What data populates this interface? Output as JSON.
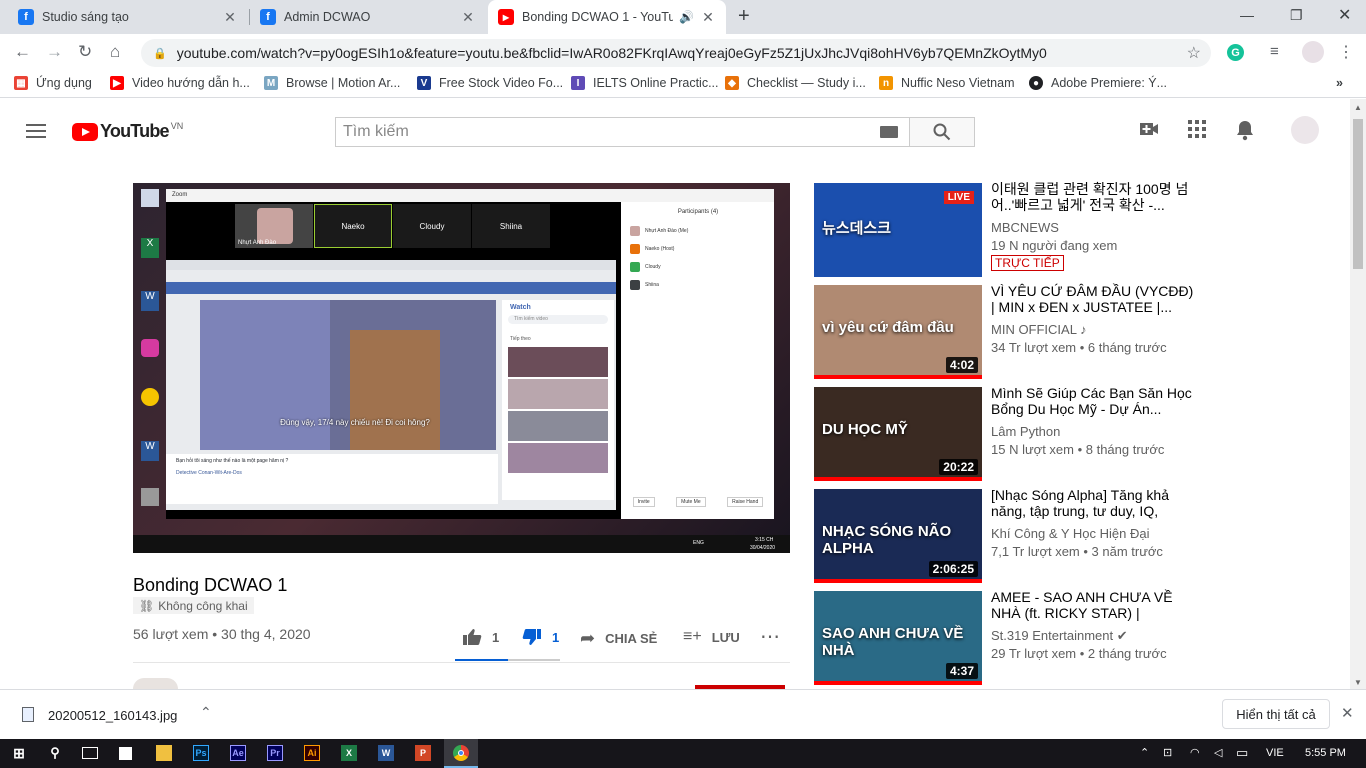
{
  "tabs": [
    {
      "title": "Studio sáng tạo",
      "color": "#1877f2",
      "glyph": "f"
    },
    {
      "title": "Admin DCWAO",
      "color": "#1877f2",
      "glyph": "f"
    },
    {
      "title": "Bonding DCWAO 1 - YouTub",
      "color": "#ff0000",
      "glyph": "▶"
    }
  ],
  "address": "youtube.com/watch?v=py0ogESIh1o&feature=youtu.be&fbclid=IwAR0o82FKrqIAwqYreaj0eGyFz5Z1jUxJhcJVqi8ohHV6yb7QEMnZkOytMy0",
  "bookmarks": [
    {
      "label": "Ứng dụng",
      "color": "#ea4335"
    },
    {
      "label": "Video hướng dẫn h...",
      "color": "#ff0000"
    },
    {
      "label": "Browse | Motion Ar...",
      "color": "#7aa6c2"
    },
    {
      "label": "Free Stock Video Fo...",
      "color": "#1a3a8f"
    },
    {
      "label": "IELTS Online Practic...",
      "color": "#5f4bb6"
    },
    {
      "label": "Checklist — Study i...",
      "color": "#e8710a"
    },
    {
      "label": "Nuffic Neso Vietnam",
      "color": "#f29400"
    },
    {
      "label": "Adobe Premiere: Ý...",
      "color": "#202124"
    }
  ],
  "youtube": {
    "logo_text": "YouTube",
    "region": "VN",
    "search_placeholder": "Tìm kiếm"
  },
  "video": {
    "title": "Bonding DCWAO 1",
    "visibility": "Không công khai",
    "views_date": "56 lượt xem • 30 thg 4, 2020",
    "likes": "1",
    "dislikes": "1",
    "share": "CHIA SẺ",
    "save": "LƯU",
    "like_ratio": 0.5
  },
  "inner": {
    "zoom_title": "Zoom",
    "participants_header": "Participants (4)",
    "participants": [
      "Nhựt Anh Đào (Me)",
      "Naeko (Host)",
      "Cloudy",
      "Shiina"
    ],
    "tiles": [
      "Nhựt Anh Đào",
      "Naeko",
      "Cloudy",
      "Shiina"
    ],
    "buttons": [
      "Invite",
      "Mute Me",
      "Raise Hand"
    ],
    "subtitle": "Đúng vậy, 17/4 này chiếu nè! Đi coi hông?",
    "watch": "Watch",
    "search_video": "Tìm kiếm video",
    "up_next": "Tiếp theo",
    "post_q": "Bạn hỏi tôi sáng như thế nào là một page hâm nị ?",
    "page_name": "Detective Conan-Wit-Are-Dos",
    "time": "3:15 CH",
    "date": "30/04/2020",
    "lang": "ENG"
  },
  "sidebar": [
    {
      "title": "이태원 클럽 관련 확진자 100명 넘어..'빠르고 넓게' 전국 확산 -...",
      "channel": "MBCNEWS",
      "meta": "19 N người đang xem",
      "live": "TRỰC TIẾP",
      "duration": "",
      "thumb_text": "뉴스데스크",
      "thumb_bg": "#1b4fae"
    },
    {
      "title": "VÌ YÊU CỨ ĐÂM ĐẦU (VYCĐĐ) | MIN x ĐEN x JUSTATEE |...",
      "channel": "MIN OFFICIAL ♪",
      "meta": "34 Tr lượt xem • 6 tháng trước",
      "live": "",
      "duration": "4:02",
      "thumb_text": "vì yêu cứ đâm đầu",
      "thumb_bg": "#b08a72"
    },
    {
      "title": "Mình Sẽ Giúp Các Bạn Săn Học Bổng Du Học Mỹ - Dự Án...",
      "channel": "Lâm Python",
      "meta": "15 N lượt xem • 8 tháng trước",
      "live": "",
      "duration": "20:22",
      "thumb_text": "DU HỌC MỸ",
      "thumb_bg": "#3a2a22"
    },
    {
      "title": "[Nhạc Sóng Alpha] Tăng khả năng, tập trung, tư duy, IQ, Sán...",
      "channel": "Khí Công & Y Học Hiện Đại",
      "meta": "7,1 Tr lượt xem • 3 năm trước",
      "live": "",
      "duration": "2:06:25",
      "thumb_text": "NHẠC SÓNG NÃO ALPHA",
      "thumb_bg": "#1a2a55"
    },
    {
      "title": "AMEE - SAO ANH CHƯA VỀ NHÀ (ft. RICKY STAR) | Official...",
      "channel": "St.319 Entertainment ✔",
      "meta": "29 Tr lượt xem • 2 tháng trước",
      "live": "",
      "duration": "4:37",
      "thumb_text": "SAO ANH CHƯA VỀ NHÀ",
      "thumb_bg": "#2a6a86"
    }
  ],
  "download": {
    "file": "20200512_160143.jpg",
    "show_all": "Hiển thị tất cả"
  },
  "taskbar": {
    "lang": "VIE",
    "time": "5:55 PM"
  }
}
